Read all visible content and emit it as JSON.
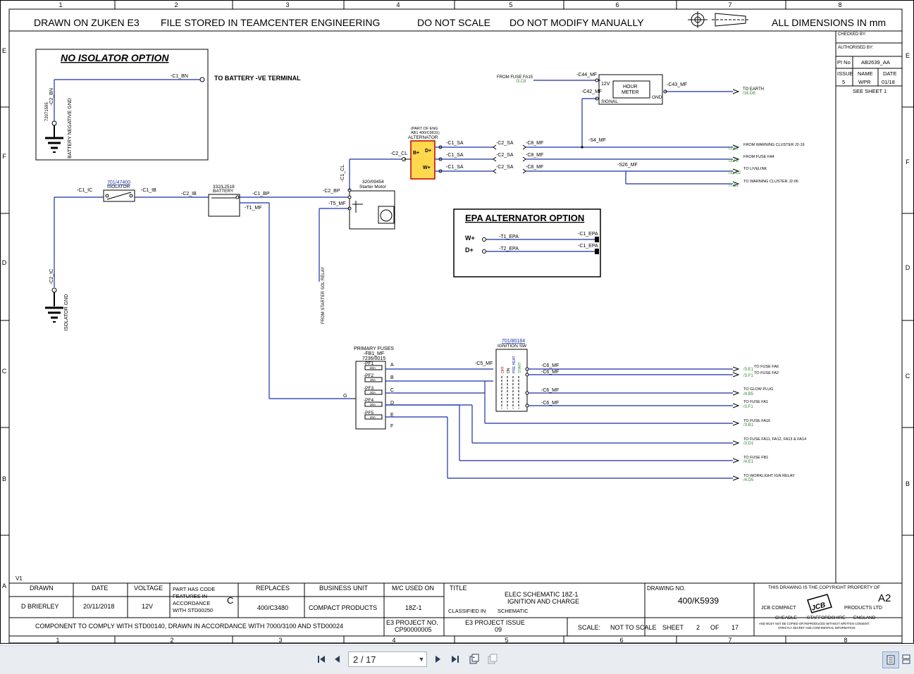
{
  "sheet": {
    "column_numbers": [
      "1",
      "2",
      "3",
      "4",
      "5",
      "6",
      "7",
      "8"
    ],
    "row_letters": [
      "E",
      "F",
      "D",
      "C",
      "B",
      "A"
    ],
    "header": {
      "drawn_on": "DRAWN ON ZUKEN E3",
      "file_stored": "FILE STORED IN TEAMCENTER ENGINEERING",
      "do_not_scale": "DO NOT SCALE",
      "do_not_modify": "DO NOT MODIFY MANUALLY",
      "all_dims": "ALL DIMENSIONS IN mm"
    },
    "side_block": {
      "checked_by": "CHECKED BY:",
      "authorised_by": "AUTHORISED BY:",
      "pi_no_label": "PI No",
      "pi_no": "AB2639_AA",
      "issue_label": "ISSUE",
      "issue": "5",
      "name_label": "NAME",
      "name": "WPR",
      "date_label": "DATE",
      "date": "01/18",
      "see_sheet": "SEE SHEET 1"
    },
    "v1": "V1"
  },
  "schematic": {
    "no_isolator": {
      "title": "NO ISOLATOR OPTION",
      "to_battery": "TO BATTERY -VE TERMINAL",
      "c1_bn": "-C1_BN",
      "c2_bn": "-C2_BN",
      "battery_gnd": "BATTERY NEGATIVE GND",
      "ref": "72071595"
    },
    "isolator": {
      "link": "701/47400",
      "label": "ISOLATOR",
      "c1_ic": "-C1_IC",
      "c1_ib": "-C1_IB",
      "c2_ib": "-C2_IB",
      "c2_ic": "-C2_IC",
      "gnd": "ISOLATOR GND"
    },
    "battery": {
      "ref": "332/L2518",
      "label": "BATTERY",
      "c1_bp": "-C1_BP",
      "t1_mf": "-T1_MF"
    },
    "starter": {
      "ref": "320/09454",
      "label": "Starter Motor",
      "c2_bp": "-C2_BP",
      "c1_cl": "-C1_CL",
      "t5_mf": "-T5_MF",
      "from_sol": "FROM STARTER SOL RELAY"
    },
    "alternator": {
      "note1": "(PART OF ENG",
      "note2": "AB1 400/C9631)",
      "label": "ALTERNATOR",
      "c2_cl": "-C2_CL",
      "b_plus": "B+",
      "d_plus": "D+",
      "w_plus": "W+",
      "c1_sa": "-C1_SA",
      "c2_sa": "-C2_SA",
      "c8_mf": "-C8_MF"
    },
    "hour_meter": {
      "label1": "HOUR",
      "label2": "METER",
      "from_fuse": "FROM FUSE FA15",
      "from_ref": "/3.C8",
      "c44_mf": "-C44_MF",
      "c42_mf": "-C42_MF",
      "c43_mf": "-C43_MF",
      "v12": "12V",
      "signal": "SIGNAL",
      "gnd": "GND",
      "to_earth": "TO EARTH",
      "to_earth_ref": "/16.D6",
      "s4_mf": "-S4_MF"
    },
    "outputs_top": [
      {
        "text": "FROM WARNING CLUSTER J2-19",
        "ref": "/7.E7"
      },
      {
        "text": "FROM FUSE FA4",
        "ref": "/3.F6"
      },
      {
        "text": "TO LIVELINK",
        "ref": "/11.D2"
      },
      {
        "text": "TO WARNING CLUSTER J2-06",
        "ref": "/7.D1"
      }
    ],
    "s26_mf": "-S26_MF",
    "epa": {
      "title": "EPA  ALTERNATOR OPTION",
      "w_plus": "W+",
      "d_plus": "D+",
      "t1_epa": "-T1_EPA",
      "t2_epa": "-T2_EPA",
      "c1_epa": "-C1_EPA"
    },
    "fuses": {
      "title": "PRIMARY FUSES",
      "ref1": "-FB1_MF",
      "ref2": "7236/0015",
      "names": [
        "-PF1",
        "-PF2",
        "-PF3",
        "-PF4",
        "-PF5"
      ],
      "ratings": [
        "60A",
        "30A",
        "30A",
        "30A",
        "40A"
      ],
      "letters": [
        "A",
        "B",
        "C",
        "D",
        "E",
        "F",
        "G"
      ]
    },
    "ignition": {
      "link": "701/80184",
      "label": "IGNITION SW",
      "c5_mf": "-C5_MF",
      "c6_mf": "-C6_MF",
      "positions": [
        "OFF",
        "ON",
        "PRE HEAT",
        "START"
      ]
    },
    "outputs_bottom": [
      {
        "text": "TO FUSE FA6",
        "ref": "/3.E1"
      },
      {
        "text": "TO FUSE FA2",
        "ref": "/3.F1"
      },
      {
        "text": "TO GLOW PLUG",
        "ref": "/4.B5"
      },
      {
        "text": "TO FUSE FA1",
        "ref": "/3.F1"
      },
      {
        "text": "TO FUSE FA16",
        "ref": "/3.B1"
      },
      {
        "text": "TO FUSE FA11, FA12, FA13 & FA14",
        "ref": "/3.D1"
      },
      {
        "text": "TO FUSE FB1",
        "ref": "/4.E1"
      },
      {
        "text": "TO WORKLIGHT IGN RELAY",
        "ref": "/4.D5"
      }
    ]
  },
  "title_block": {
    "drawn_label": "DRAWN",
    "drawn": "D BRIERLEY",
    "date_label": "DATE",
    "date": "20/11/2018",
    "voltage_label": "VOLTAGE",
    "voltage": "12V",
    "part_code_1": "PART HAS CODE",
    "part_code_2": "FEATURES IN",
    "part_code_3": "ACCORDANCE",
    "part_code_4": "WITH STD00250",
    "part_code_class": "C",
    "replaces_label": "REPLACES",
    "replaces": "400/C3480",
    "bu_label": "BUSINESS UNIT",
    "bu": "COMPACT PRODUCTS",
    "mc_label": "M/C USED ON",
    "mc": "18Z-1",
    "title_label": "TITLE",
    "title_1": "ELEC SCHEMATIC 18Z-1",
    "title_2": "IGNITION AND CHARGE",
    "classified_label": "CLASSIFIED IN",
    "classified": "SCHEMATIC",
    "drawing_no_label": "DRAWING NO.",
    "drawing_no": "400/K5939",
    "copyright": "THIS DRAWING IS THE COPYRIGHT PROPERTY OF",
    "size": "A2",
    "jcb_compact": "JCB COMPACT",
    "products_ltd": "PRODUCTS LTD",
    "logo_text": "JCB",
    "cheadle": "CHEADLE",
    "staffordshire": "STAFFORDSHIRE",
    "england": "ENGLAND",
    "legal_1": "AND MUST NOT BE COPIED OR REPRODUCED WITHOUT WRITTEN CONSENT.",
    "legal_2": "STRICTLY SECRET AND CONFIDENTIAL INFORMATION",
    "component_note": "COMPONENT TO COMPLY WITH STD00140, DRAWN IN ACCORDANCE WITH 7000/3100 AND STD00024",
    "e3_project_label": "E3 PROJECT NO.",
    "e3_project": "CP90000005",
    "e3_issue_label": "E3 PROJECT ISSUE",
    "e3_issue": "09",
    "scale_label": "SCALE:",
    "scale": "NOT TO SCALE",
    "sheet_label": "SHEET",
    "sheet": "2",
    "of_label": "OF",
    "of": "17"
  },
  "viewer": {
    "page_value": "2 / 17"
  }
}
